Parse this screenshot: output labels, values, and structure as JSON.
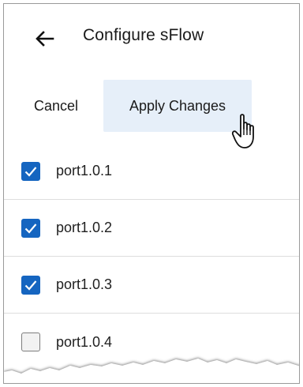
{
  "header": {
    "title": "Configure sFlow",
    "back_icon": "arrow-left-icon"
  },
  "actions": {
    "cancel_label": "Cancel",
    "apply_label": "Apply Changes"
  },
  "ports": [
    {
      "label": "port1.0.1",
      "checked": true
    },
    {
      "label": "port1.0.2",
      "checked": true
    },
    {
      "label": "port1.0.3",
      "checked": true
    },
    {
      "label": "port1.0.4",
      "checked": false
    }
  ],
  "colors": {
    "accent": "#1565c0",
    "apply_button_bg": "#e6eff9",
    "divider": "#dedede"
  }
}
